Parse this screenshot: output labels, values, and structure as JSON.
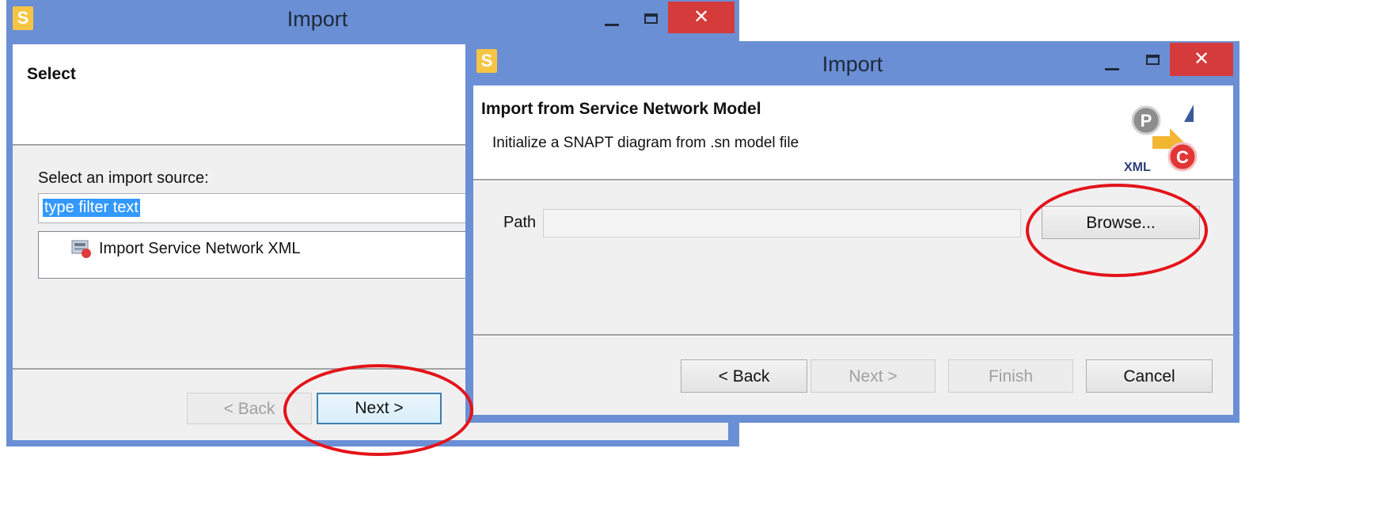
{
  "back_dialog": {
    "title": "Import",
    "app_icon_letter": "S",
    "header_title": "Select",
    "prompt_label": "Select an import source:",
    "filter_value": "type filter text",
    "tree_items": [
      {
        "label": "Import Service Network XML",
        "icon": "xml-import-icon"
      }
    ],
    "buttons": {
      "back": "< Back",
      "next": "Next >"
    }
  },
  "front_dialog": {
    "title": "Import",
    "app_icon_letter": "S",
    "header_title": "Import from Service Network Model",
    "header_description": "Initialize a SNAPT diagram from .sn model file",
    "banner_icon": "xml-pc-conversion-icon",
    "banner_text": "XML",
    "path_label": "Path",
    "path_value": "",
    "browse_label": "Browse...",
    "buttons": {
      "back": "< Back",
      "next": "Next >",
      "finish": "Finish",
      "cancel": "Cancel"
    }
  },
  "colors": {
    "titlebar": "#6b8fd4",
    "close_button": "#d63b3b",
    "highlight_circle": "#e4131a",
    "selection": "#3399ff"
  }
}
